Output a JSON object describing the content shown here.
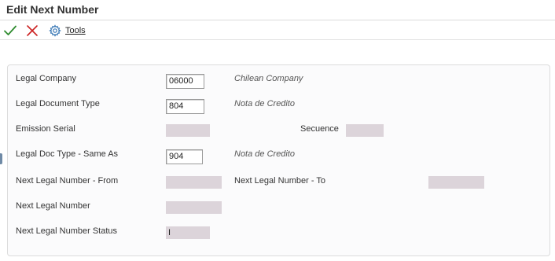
{
  "window": {
    "title": "Edit Next Number"
  },
  "toolbar": {
    "ok_icon": "checkmark-icon",
    "cancel_icon": "x-icon",
    "tools_icon": "gear-icon",
    "tools_label": "Tools"
  },
  "colors": {
    "ok": "#2e8b2e",
    "cancel": "#cc2222",
    "tools": "#3a78b5",
    "readonly_fill": "#dcd4da"
  },
  "form": {
    "legal_company": {
      "label": "Legal Company",
      "value": "06000",
      "description": "Chilean Company"
    },
    "legal_document_type": {
      "label": "Legal Document Type",
      "value": "804",
      "description": "Nota de Credito"
    },
    "emission_serial": {
      "label": "Emission Serial",
      "value": ""
    },
    "secuence": {
      "label": "Secuence",
      "value": ""
    },
    "legal_doc_type_same_as": {
      "label": "Legal Doc Type - Same As",
      "value": "904",
      "description": "Nota de Credito"
    },
    "next_legal_number_from": {
      "label": "Next Legal Number - From",
      "value": ""
    },
    "next_legal_number_to": {
      "label": "Next Legal Number - To",
      "value": ""
    },
    "next_legal_number": {
      "label": "Next Legal Number",
      "value": ""
    },
    "next_legal_number_status": {
      "label": "Next Legal Number Status",
      "value": "I"
    }
  }
}
